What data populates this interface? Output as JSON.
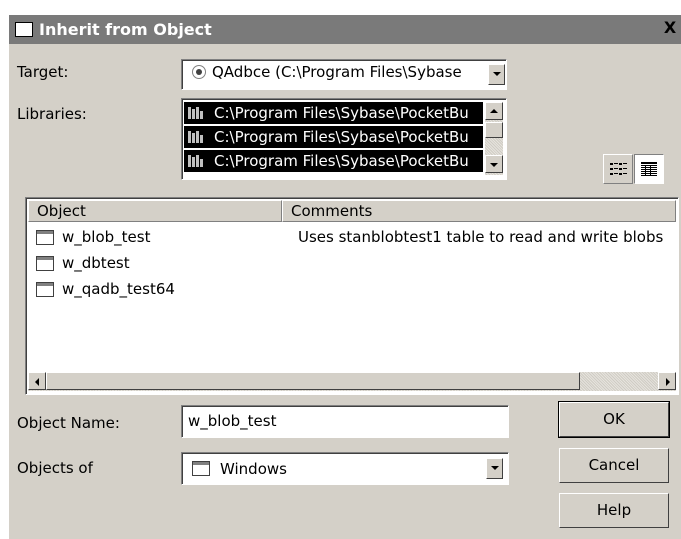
{
  "window": {
    "title": "Inherit from Object",
    "close_label": "X"
  },
  "target": {
    "label": "Target:",
    "value": "QAdbce (C:\\Program Files\\Sybase"
  },
  "libraries": {
    "label": "Libraries:",
    "items": [
      "C:\\Program Files\\Sybase\\PocketBu",
      "C:\\Program Files\\Sybase\\PocketBu",
      "C:\\Program Files\\Sybase\\PocketBu"
    ]
  },
  "list": {
    "columns": [
      "Object",
      "Comments"
    ],
    "rows": [
      {
        "name": "w_blob_test",
        "comment": "Uses stanblobtest1 table to read and write blobs"
      },
      {
        "name": "w_dbtest",
        "comment": ""
      },
      {
        "name": "w_qadb_test64",
        "comment": ""
      }
    ]
  },
  "object_name": {
    "label": "Object Name:",
    "value": "w_blob_test"
  },
  "objects_of": {
    "label": "Objects of",
    "value": "Windows"
  },
  "buttons": {
    "ok": "OK",
    "cancel": "Cancel",
    "help": "Help"
  },
  "icons": {
    "close": "close-icon",
    "radio": "radio-icon",
    "library": "library-icon",
    "list_view": "list-view-icon",
    "details_view": "details-view-icon",
    "window_object": "window-object-icon"
  },
  "colors": {
    "titlebar": "#7a7a7a",
    "dialog": "#d4d0c8",
    "selection": "#000000"
  }
}
